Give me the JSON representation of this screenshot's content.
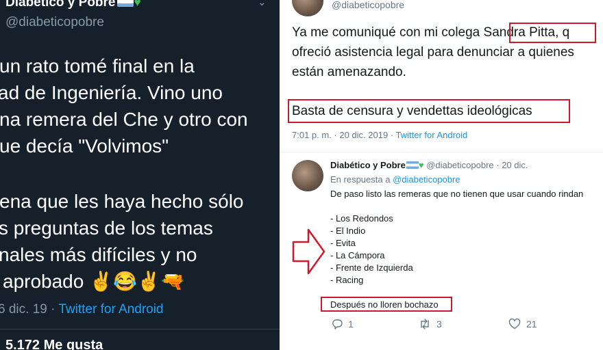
{
  "left_tweet": {
    "display_name": "Diabético y Pobre",
    "handle": "@diabeticopobre",
    "text_lines": [
      "un rato tomé final en la",
      "ad de Ingeniería. Vino uno",
      "na remera del Che y otro con",
      "ue decía \"Volvimos\"",
      "ena que les haya hecho sólo",
      "s preguntas de los temas",
      "nales más difíciles y no",
      "aprobado ✌😂✌🔫"
    ],
    "date": "6 dic. 19",
    "separator": "·",
    "source": "Twitter for Android",
    "stats_partial": "5.172 Me gusta"
  },
  "right_tweet": {
    "handle": "@diabeticopobre",
    "text_line_1_before": "Ya me comuniqué con mi colega ",
    "text_highlight_name": "Sandra Pitta,",
    "text_line_1_after": " q",
    "text_line_2": "ofreció asistencia legal para denunciar a quienes",
    "text_line_3": "están amenazando.",
    "text_boxed": "Basta de censura y vendettas ideológicas",
    "time": "7:01 p. m. · 20 dic. 2019 · ",
    "source": "Twitter for Android"
  },
  "reply": {
    "display_name": "Diabético y Pobre",
    "handle": "@diabeticopobre",
    "date": " · 20 dic.",
    "replying_to_prefix": "En respuesta a ",
    "replying_to_handle": "@diabeticopobre",
    "line_intro": "De paso listo las remeras que no tienen que usar cuando rindan",
    "list": [
      "- Los Redondos",
      "- El Indio",
      "- Evita",
      "- La Cámpora",
      "- Frente de Izquierda",
      "- Racing"
    ],
    "closing": "Después no lloren bochazo",
    "reply_count": "1",
    "retweet_count": "3",
    "like_count": "21"
  },
  "colors": {
    "dark_bg": "#15202b",
    "twitter_blue": "#1da1f2",
    "highlight_red": "#d0182b",
    "muted_gray": "#657786"
  }
}
